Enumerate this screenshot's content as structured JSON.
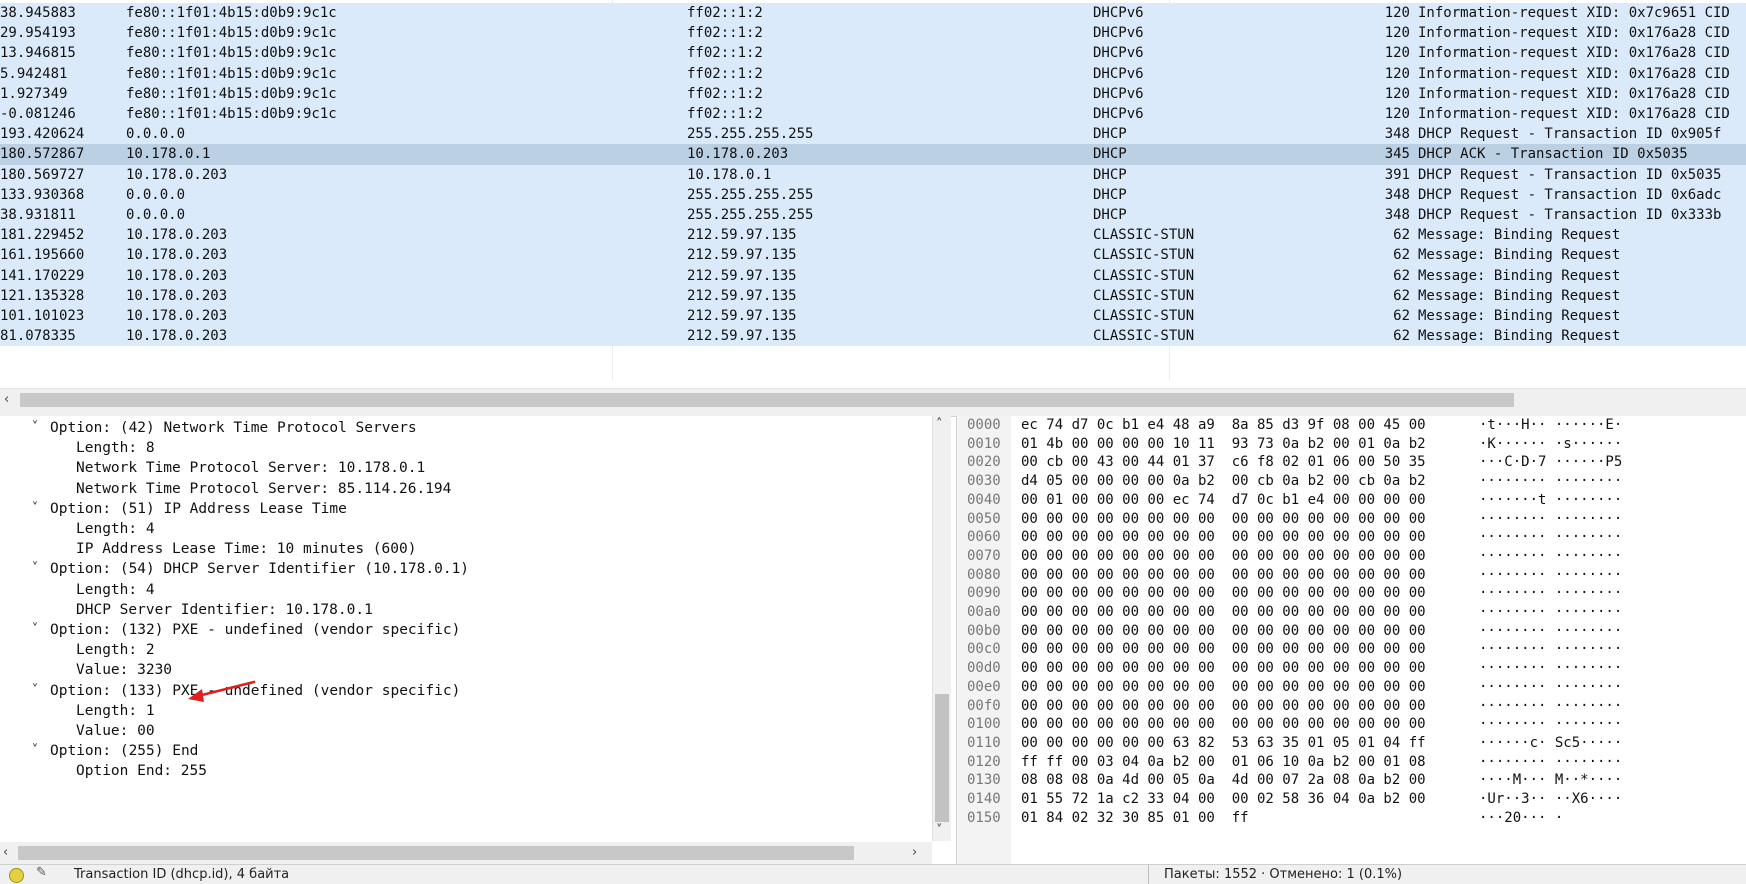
{
  "packets": [
    {
      "time": "38.945883",
      "src": "fe80::1f01:4b15:d0b9:9c1c",
      "dst": "ff02::1:2",
      "proto": "DHCPv6",
      "len": "120",
      "info": "Information-request XID: 0x7c9651 CID"
    },
    {
      "time": "29.954193",
      "src": "fe80::1f01:4b15:d0b9:9c1c",
      "dst": "ff02::1:2",
      "proto": "DHCPv6",
      "len": "120",
      "info": "Information-request XID: 0x176a28 CID"
    },
    {
      "time": "13.946815",
      "src": "fe80::1f01:4b15:d0b9:9c1c",
      "dst": "ff02::1:2",
      "proto": "DHCPv6",
      "len": "120",
      "info": "Information-request XID: 0x176a28 CID"
    },
    {
      "time": "5.942481",
      "src": "fe80::1f01:4b15:d0b9:9c1c",
      "dst": "ff02::1:2",
      "proto": "DHCPv6",
      "len": "120",
      "info": "Information-request XID: 0x176a28 CID"
    },
    {
      "time": "1.927349",
      "src": "fe80::1f01:4b15:d0b9:9c1c",
      "dst": "ff02::1:2",
      "proto": "DHCPv6",
      "len": "120",
      "info": "Information-request XID: 0x176a28 CID"
    },
    {
      "time": "-0.081246",
      "src": "fe80::1f01:4b15:d0b9:9c1c",
      "dst": "ff02::1:2",
      "proto": "DHCPv6",
      "len": "120",
      "info": "Information-request XID: 0x176a28 CID"
    },
    {
      "time": "193.420624",
      "src": "0.0.0.0",
      "dst": "255.255.255.255",
      "proto": "DHCP",
      "len": "348",
      "info": "DHCP Request  - Transaction ID 0x905f"
    },
    {
      "time": "180.572867",
      "src": "10.178.0.1",
      "dst": "10.178.0.203",
      "proto": "DHCP",
      "len": "345",
      "info": "DHCP ACK      - Transaction ID 0x5035",
      "selected": true
    },
    {
      "time": "180.569727",
      "src": "10.178.0.203",
      "dst": "10.178.0.1",
      "proto": "DHCP",
      "len": "391",
      "info": "DHCP Request  - Transaction ID 0x5035"
    },
    {
      "time": "133.930368",
      "src": "0.0.0.0",
      "dst": "255.255.255.255",
      "proto": "DHCP",
      "len": "348",
      "info": "DHCP Request  - Transaction ID 0x6adc"
    },
    {
      "time": "38.931811",
      "src": "0.0.0.0",
      "dst": "255.255.255.255",
      "proto": "DHCP",
      "len": "348",
      "info": "DHCP Request  - Transaction ID 0x333b"
    },
    {
      "time": "181.229452",
      "src": "10.178.0.203",
      "dst": "212.59.97.135",
      "proto": "CLASSIC-STUN",
      "len": "62",
      "info": "Message: Binding Request"
    },
    {
      "time": "161.195660",
      "src": "10.178.0.203",
      "dst": "212.59.97.135",
      "proto": "CLASSIC-STUN",
      "len": "62",
      "info": "Message: Binding Request"
    },
    {
      "time": "141.170229",
      "src": "10.178.0.203",
      "dst": "212.59.97.135",
      "proto": "CLASSIC-STUN",
      "len": "62",
      "info": "Message: Binding Request"
    },
    {
      "time": "121.135328",
      "src": "10.178.0.203",
      "dst": "212.59.97.135",
      "proto": "CLASSIC-STUN",
      "len": "62",
      "info": "Message: Binding Request"
    },
    {
      "time": "101.101023",
      "src": "10.178.0.203",
      "dst": "212.59.97.135",
      "proto": "CLASSIC-STUN",
      "len": "62",
      "info": "Message: Binding Request"
    },
    {
      "time": "81.078335",
      "src": "10.178.0.203",
      "dst": "212.59.97.135",
      "proto": "CLASSIC-STUN",
      "len": "62",
      "info": "Message: Binding Request"
    }
  ],
  "details": [
    {
      "level": 0,
      "expanded": true,
      "text": "Option: (42) Network Time Protocol Servers"
    },
    {
      "level": 1,
      "text": "Length: 8"
    },
    {
      "level": 1,
      "text": "Network Time Protocol Server: 10.178.0.1"
    },
    {
      "level": 1,
      "text": "Network Time Protocol Server: 85.114.26.194"
    },
    {
      "level": 0,
      "expanded": true,
      "text": "Option: (51) IP Address Lease Time"
    },
    {
      "level": 1,
      "text": "Length: 4"
    },
    {
      "level": 1,
      "text": "IP Address Lease Time: 10 minutes (600)"
    },
    {
      "level": 0,
      "expanded": true,
      "text": "Option: (54) DHCP Server Identifier (10.178.0.1)"
    },
    {
      "level": 1,
      "text": "Length: 4"
    },
    {
      "level": 1,
      "text": "DHCP Server Identifier: 10.178.0.1"
    },
    {
      "level": 0,
      "expanded": true,
      "text": "Option: (132) PXE - undefined (vendor specific)"
    },
    {
      "level": 1,
      "text": "Length: 2"
    },
    {
      "level": 1,
      "text": "Value: 3230"
    },
    {
      "level": 0,
      "expanded": true,
      "text": "Option: (133) PXE - undefined (vendor specific)"
    },
    {
      "level": 1,
      "text": "Length: 1"
    },
    {
      "level": 1,
      "text": "Value: 00"
    },
    {
      "level": 0,
      "expanded": true,
      "text": "Option: (255) End"
    },
    {
      "level": 1,
      "text": "Option End: 255"
    }
  ],
  "hex": [
    {
      "offset": "0000",
      "bytes": "ec 74 d7 0c b1 e4 48 a9  8a 85 d3 9f 08 00 45 00",
      "ascii": "·t···H·· ······E·"
    },
    {
      "offset": "0010",
      "bytes": "01 4b 00 00 00 00 10 11  93 73 0a b2 00 01 0a b2",
      "ascii": "·K······ ·s······"
    },
    {
      "offset": "0020",
      "bytes": "00 cb 00 43 00 44 01 37  c6 f8 02 01 06 00 50 35",
      "ascii": "···C·D·7 ······P5"
    },
    {
      "offset": "0030",
      "bytes": "d4 05 00 00 00 00 0a b2  00 cb 0a b2 00 cb 0a b2",
      "ascii": "········ ········"
    },
    {
      "offset": "0040",
      "bytes": "00 01 00 00 00 00 ec 74  d7 0c b1 e4 00 00 00 00",
      "ascii": "·······t ········"
    },
    {
      "offset": "0050",
      "bytes": "00 00 00 00 00 00 00 00  00 00 00 00 00 00 00 00",
      "ascii": "········ ········"
    },
    {
      "offset": "0060",
      "bytes": "00 00 00 00 00 00 00 00  00 00 00 00 00 00 00 00",
      "ascii": "········ ········"
    },
    {
      "offset": "0070",
      "bytes": "00 00 00 00 00 00 00 00  00 00 00 00 00 00 00 00",
      "ascii": "········ ········"
    },
    {
      "offset": "0080",
      "bytes": "00 00 00 00 00 00 00 00  00 00 00 00 00 00 00 00",
      "ascii": "········ ········"
    },
    {
      "offset": "0090",
      "bytes": "00 00 00 00 00 00 00 00  00 00 00 00 00 00 00 00",
      "ascii": "········ ········"
    },
    {
      "offset": "00a0",
      "bytes": "00 00 00 00 00 00 00 00  00 00 00 00 00 00 00 00",
      "ascii": "········ ········"
    },
    {
      "offset": "00b0",
      "bytes": "00 00 00 00 00 00 00 00  00 00 00 00 00 00 00 00",
      "ascii": "········ ········"
    },
    {
      "offset": "00c0",
      "bytes": "00 00 00 00 00 00 00 00  00 00 00 00 00 00 00 00",
      "ascii": "········ ········"
    },
    {
      "offset": "00d0",
      "bytes": "00 00 00 00 00 00 00 00  00 00 00 00 00 00 00 00",
      "ascii": "········ ········"
    },
    {
      "offset": "00e0",
      "bytes": "00 00 00 00 00 00 00 00  00 00 00 00 00 00 00 00",
      "ascii": "········ ········"
    },
    {
      "offset": "00f0",
      "bytes": "00 00 00 00 00 00 00 00  00 00 00 00 00 00 00 00",
      "ascii": "········ ········"
    },
    {
      "offset": "0100",
      "bytes": "00 00 00 00 00 00 00 00  00 00 00 00 00 00 00 00",
      "ascii": "········ ········"
    },
    {
      "offset": "0110",
      "bytes": "00 00 00 00 00 00 63 82  53 63 35 01 05 01 04 ff",
      "ascii": "······c· Sc5·····"
    },
    {
      "offset": "0120",
      "bytes": "ff ff 00 03 04 0a b2 00  01 06 10 0a b2 00 01 08",
      "ascii": "········ ········"
    },
    {
      "offset": "0130",
      "bytes": "08 08 08 0a 4d 00 05 0a  4d 00 07 2a 08 0a b2 00",
      "ascii": "····M··· M··*····"
    },
    {
      "offset": "0140",
      "bytes": "01 55 72 1a c2 33 04 00  00 02 58 36 04 0a b2 00",
      "ascii": "·Ur··3·· ··X6····"
    },
    {
      "offset": "0150",
      "bytes": "01 84 02 32 30 85 01 00  ff",
      "ascii": "···20··· ·"
    }
  ],
  "statusbar": {
    "left": "Transaction ID (dhcp.id), 4 байта",
    "right": "Пакеты: 1552 · Отменено: 1 (0.1%)"
  },
  "colors": {
    "row_bg": "#dbeafb",
    "row_selected_bg": "#bcd0e4",
    "annotation_arrow": "#e02020"
  },
  "icons": {
    "expand": "chevron-down-icon",
    "scroll_left": "arrow-left-icon",
    "scroll_right": "arrow-right-icon",
    "scroll_up": "arrow-up-icon",
    "scroll_down": "arrow-down-icon",
    "status": "status-led-icon",
    "edit": "edit-comment-icon"
  }
}
